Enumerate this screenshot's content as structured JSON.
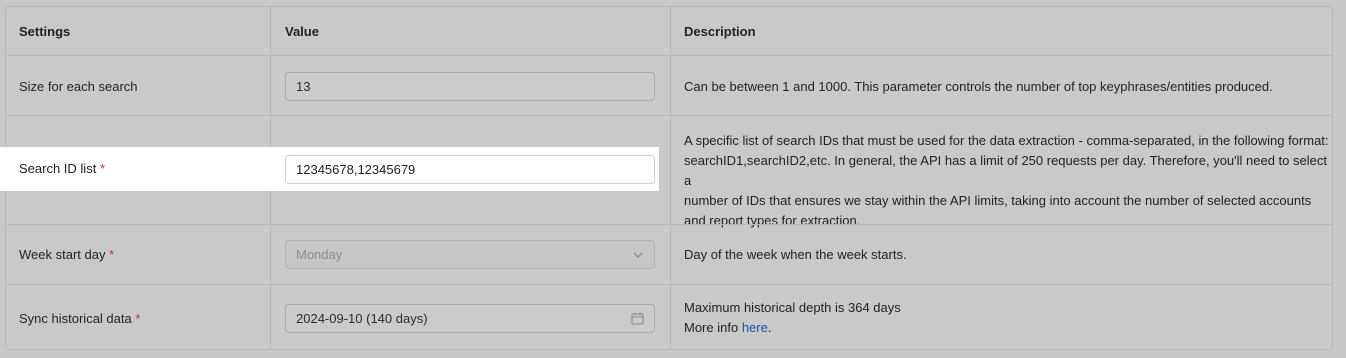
{
  "headers": {
    "settings": "Settings",
    "value": "Value",
    "description": "Description"
  },
  "required_mark": "*",
  "rows": [
    {
      "label": "Size for each search",
      "value": "13",
      "description": "Can be between 1 and 1000. This parameter controls the number of top keyphrases/entities produced."
    },
    {
      "label": "Search ID list",
      "value": "12345678,12345679",
      "description_lines": [
        "A specific list of search IDs that must be used for the data extraction - comma-separated, in the following format:",
        "searchID1,searchID2,etc. In general, the API has a limit of 250 requests per day. Therefore, you'll need to select a",
        "number of IDs that ensures we stay within the API limits, taking into account the number of selected accounts",
        "and report types for extraction."
      ]
    },
    {
      "label": "Week start day",
      "value": "Monday",
      "description": "Day of the week when the week starts."
    },
    {
      "label": "Sync historical data",
      "value": "2024-09-10 (140 days)",
      "description_line1": "Maximum historical depth is 364 days",
      "description_line2_prefix": "More info ",
      "description_link": "here",
      "description_line2_suffix": "."
    }
  ],
  "icons": {
    "select": "chevron-down-icon",
    "date": "calendar-icon"
  }
}
